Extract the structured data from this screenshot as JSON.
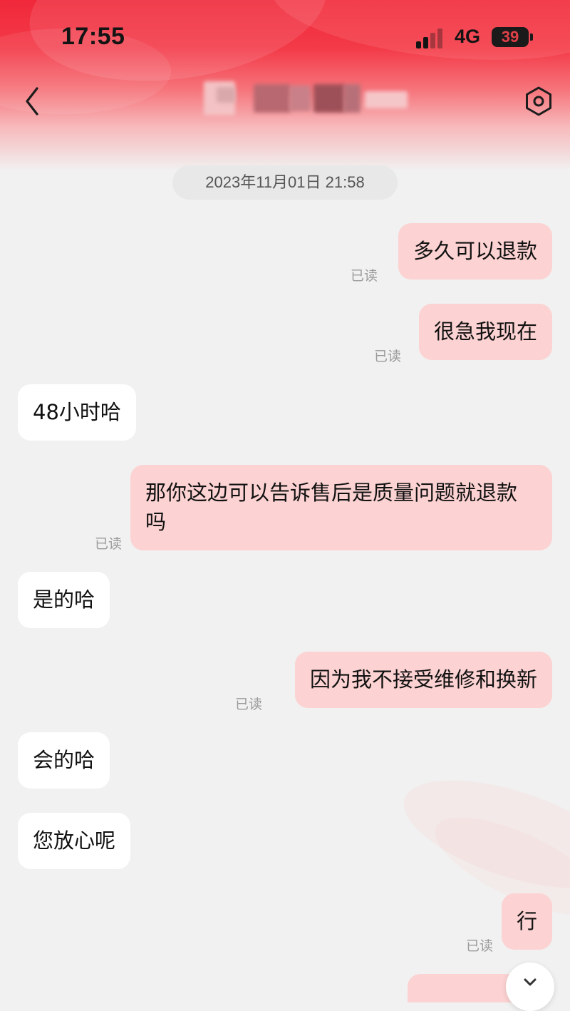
{
  "status_bar": {
    "time": "17:55",
    "network": "4G",
    "battery": "39"
  },
  "header": {
    "title": "",
    "back_icon": "chevron-left-icon",
    "settings_icon": "hexagon-gear-icon"
  },
  "colors": {
    "header_red": "#f0283a",
    "outgoing_bubble": "#fcd2d2",
    "incoming_bubble": "#ffffff",
    "background": "#f1f1f1"
  },
  "chat": {
    "timestamp": "2023年11月01日 21:58",
    "messages": [
      {
        "side": "out",
        "text": "多久可以退款",
        "status": "已读"
      },
      {
        "side": "out",
        "text": "很急我现在",
        "status": "已读"
      },
      {
        "side": "in",
        "text": "48小时哈"
      },
      {
        "side": "out",
        "text": "那你这边可以告诉售后是质量问题就退款吗",
        "status": "已读"
      },
      {
        "side": "in",
        "text": "是的哈"
      },
      {
        "side": "out",
        "text": "因为我不接受维修和换新",
        "status": "已读"
      },
      {
        "side": "in",
        "text": "会的哈"
      },
      {
        "side": "in",
        "text": "您放心呢"
      },
      {
        "side": "out",
        "text": "行",
        "status": "已读"
      }
    ]
  },
  "scroll_down_icon": "chevron-down-icon"
}
